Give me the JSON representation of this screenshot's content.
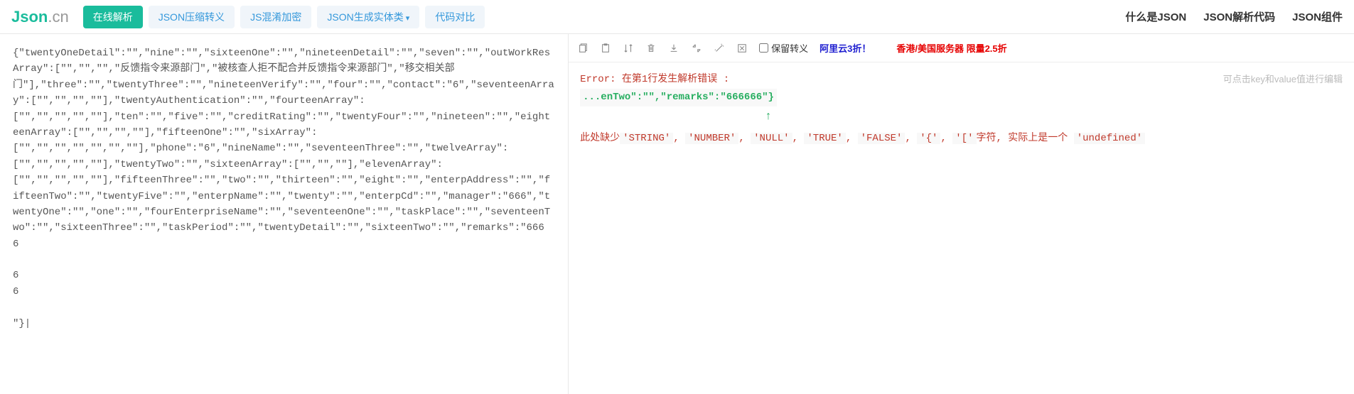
{
  "logo": {
    "part1": "Json",
    "part2": ".cn"
  },
  "topnav": {
    "parse": "在线解析",
    "compress": "JSON压缩转义",
    "obfuscate": "JS混淆加密",
    "entity": "JSON生成实体类",
    "diff": "代码对比"
  },
  "rightnav": {
    "what": "什么是JSON",
    "code": "JSON解析代码",
    "component": "JSON组件"
  },
  "input_text": "{\"twentyOneDetail\":\"\",\"nine\":\"\",\"sixteenOne\":\"\",\"nineteenDetail\":\"\",\"seven\":\"\",\"outWorkResArray\":[\"\",\"\",\"\",\"反馈指令来源部门\",\"被核查人拒不配合并反馈指令来源部门\",\"移交相关部\n门\"],\"three\":\"\",\"twentyThree\":\"\",\"nineteenVerify\":\"\",\"four\":\"\",\"contact\":\"6\",\"seventeenArray\":[\"\",\"\",\"\",\"\"],\"twentyAuthentication\":\"\",\"fourteenArray\":\n[\"\",\"\",\"\",\"\",\"\"],\"ten\":\"\",\"five\":\"\",\"creditRating\":\"\",\"twentyFour\":\"\",\"nineteen\":\"\",\"eighteenArray\":[\"\",\"\",\"\",\"\"],\"fifteenOne\":\"\",\"sixArray\":\n[\"\",\"\",\"\",\"\",\"\",\"\",\"\"],\"phone\":\"6\",\"nineName\":\"\",\"seventeenThree\":\"\",\"twelveArray\":\n[\"\",\"\",\"\",\"\",\"\"],\"twentyTwo\":\"\",\"sixteenArray\":[\"\",\"\",\"\"],\"elevenArray\":\n[\"\",\"\",\"\",\"\",\"\"],\"fifteenThree\":\"\",\"two\":\"\",\"thirteen\":\"\",\"eight\":\"\",\"enterpAddress\":\"\",\"fifteenTwo\":\"\",\"twentyFive\":\"\",\"enterpName\":\"\",\"twenty\":\"\",\"enterpCd\":\"\",\"manager\":\"666\",\"twentyOne\":\"\",\"one\":\"\",\"fourEnterpriseName\":\"\",\"seventeenOne\":\"\",\"taskPlace\":\"\",\"seventeenTwo\":\"\",\"sixteenThree\":\"\",\"taskPeriod\":\"\",\"twentyDetail\":\"\",\"sixteenTwo\":\"\",\"remarks\":\"666\n6\n\n6\n6\n\n\"}|",
  "toolbar": {
    "keep_escape": "保留转义",
    "promo1": "阿里云3折！",
    "promo2": "香港/美国服务器 限量2.5折"
  },
  "result": {
    "hint": "可点击key和value值进行编辑",
    "error_prefix": "Error: ",
    "error_line": "在第1行发生解析错误 :",
    "snippet": "...enTwo\":\"\",\"remarks\":\"666666\"}",
    "msg_prefix": "此处缺少",
    "tokens": [
      "'STRING'",
      "'NUMBER'",
      "'NULL'",
      "'TRUE'",
      "'FALSE'",
      "'{'",
      "'['"
    ],
    "msg_middle": "字符, 实际上是一个 ",
    "undefined_token": "'undefined'"
  }
}
